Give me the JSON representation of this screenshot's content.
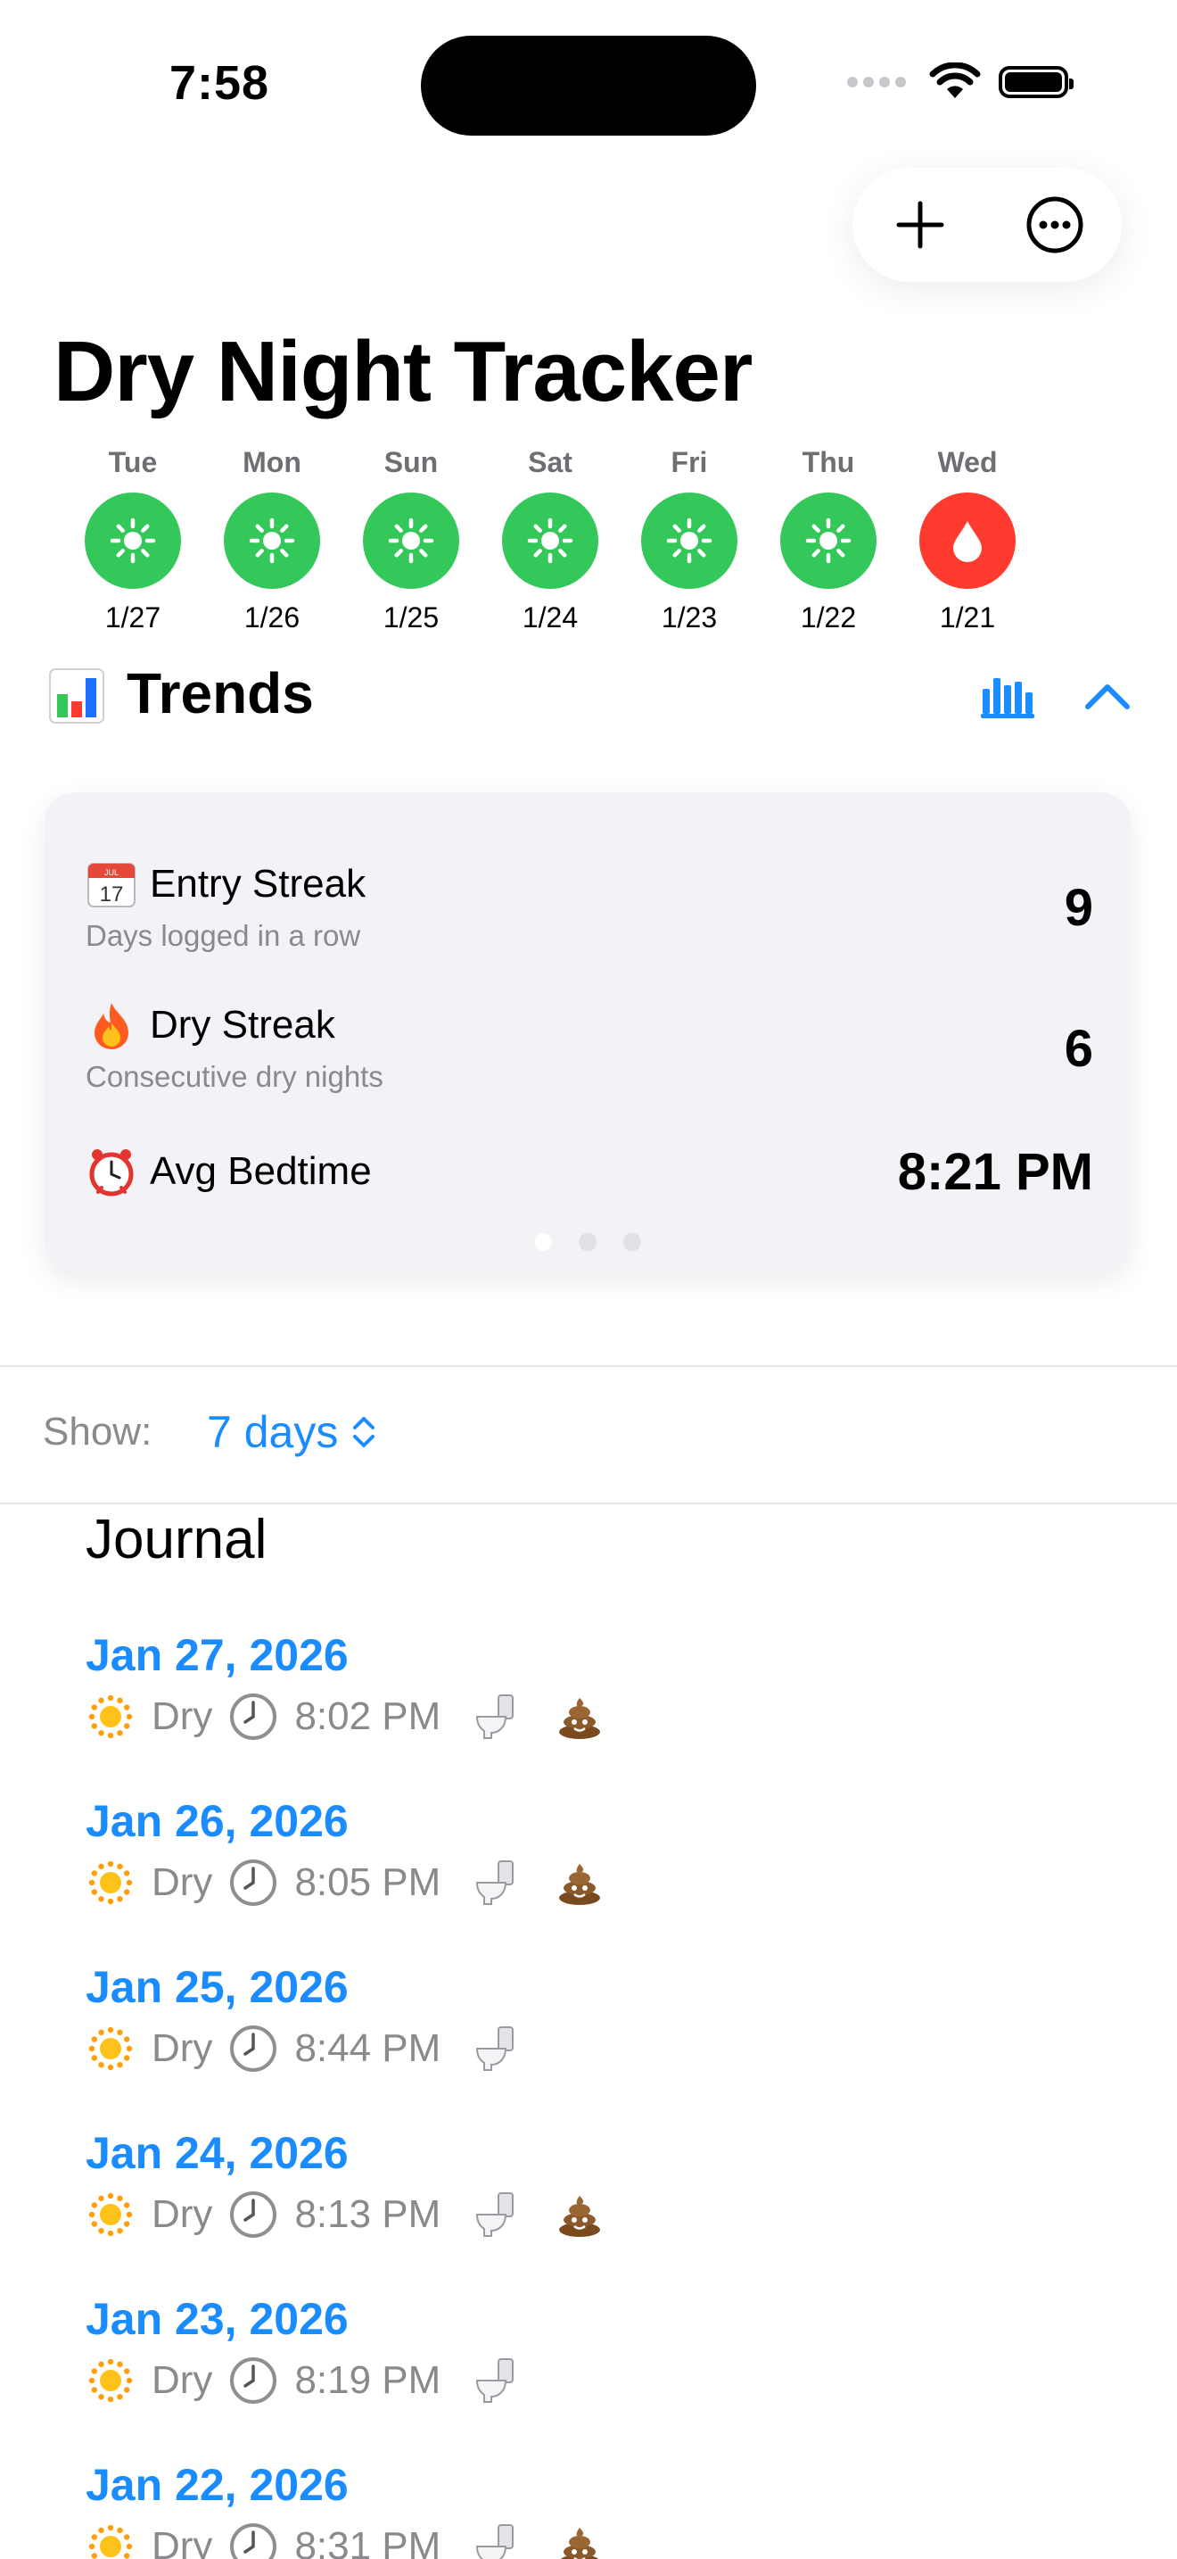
{
  "status_bar": {
    "time": "7:58"
  },
  "title": "Dry Night Tracker",
  "colors": {
    "dry": "#34c759",
    "wet": "#ff3b30",
    "accent": "#1a8cff"
  },
  "week": [
    {
      "day": "Tue",
      "date": "1/27",
      "status": "dry",
      "icon": "sun-icon"
    },
    {
      "day": "Mon",
      "date": "1/26",
      "status": "dry",
      "icon": "sun-icon"
    },
    {
      "day": "Sun",
      "date": "1/25",
      "status": "dry",
      "icon": "sun-icon"
    },
    {
      "day": "Sat",
      "date": "1/24",
      "status": "dry",
      "icon": "sun-icon"
    },
    {
      "day": "Fri",
      "date": "1/23",
      "status": "dry",
      "icon": "sun-icon"
    },
    {
      "day": "Thu",
      "date": "1/22",
      "status": "dry",
      "icon": "sun-icon"
    },
    {
      "day": "Wed",
      "date": "1/21",
      "status": "wet",
      "icon": "drop-icon"
    }
  ],
  "trends": {
    "title": "Trends",
    "stats": [
      {
        "emoji": "calendar-icon",
        "label": "Entry Streak",
        "sub": "Days logged in a row",
        "value": "9"
      },
      {
        "emoji": "fire-icon",
        "label": "Dry Streak",
        "sub": "Consecutive dry nights",
        "value": "6"
      },
      {
        "emoji": "alarm-clock-icon",
        "label": "Avg Bedtime",
        "sub": "",
        "value": "8:21 PM"
      }
    ],
    "calendar_day": "17",
    "calendar_month": "JUL"
  },
  "filter": {
    "label": "Show:",
    "value": "7 days"
  },
  "journal": {
    "title": "Journal",
    "entries": [
      {
        "date": "Jan 27, 2026",
        "status": "Dry",
        "time": "8:02 PM",
        "pee": true,
        "poop": true
      },
      {
        "date": "Jan 26, 2026",
        "status": "Dry",
        "time": "8:05 PM",
        "pee": true,
        "poop": true
      },
      {
        "date": "Jan 25, 2026",
        "status": "Dry",
        "time": "8:44 PM",
        "pee": true,
        "poop": false
      },
      {
        "date": "Jan 24, 2026",
        "status": "Dry",
        "time": "8:13 PM",
        "pee": true,
        "poop": true
      },
      {
        "date": "Jan 23, 2026",
        "status": "Dry",
        "time": "8:19 PM",
        "pee": true,
        "poop": false
      },
      {
        "date": "Jan 22, 2026",
        "status": "Dry",
        "time": "8:31 PM",
        "pee": true,
        "poop": true
      }
    ]
  }
}
